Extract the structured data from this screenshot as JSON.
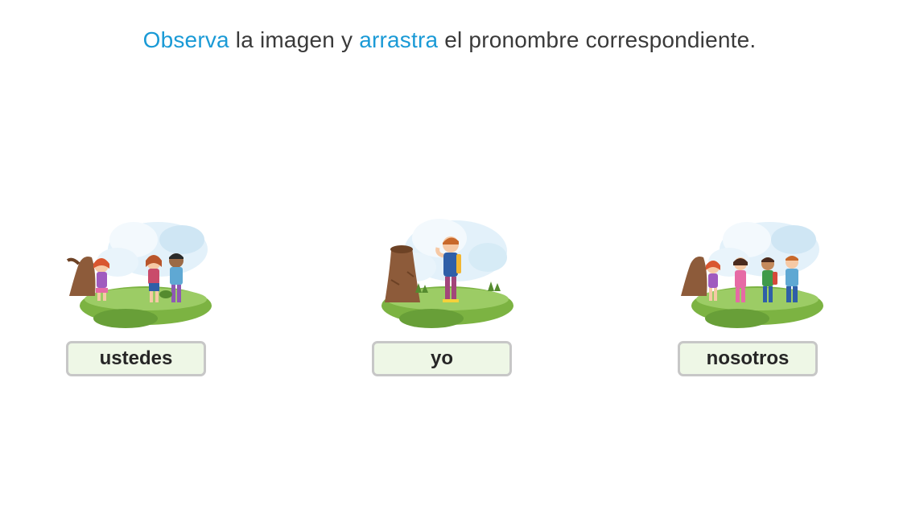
{
  "instruction": {
    "word1": "Observa",
    "text2": " la imagen y ",
    "word3": "arrastra",
    "text4": " el pronombre correspondiente."
  },
  "colors": {
    "accent": "#1a9ad6",
    "box_fill": "#eef7e6",
    "box_border": "#c7c7c7",
    "grass": "#7cb342",
    "sky": "#d8ecf7"
  },
  "cards": [
    {
      "image_icon": "three-children-scene-icon",
      "pronoun": "ustedes"
    },
    {
      "image_icon": "single-boy-scene-icon",
      "pronoun": "yo"
    },
    {
      "image_icon": "four-children-scene-icon",
      "pronoun": "nosotros"
    }
  ]
}
